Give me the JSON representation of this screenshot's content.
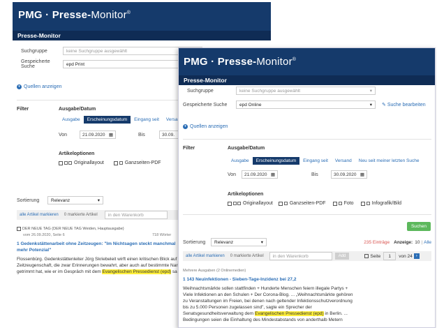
{
  "back": {
    "logo": {
      "pmg": "PMG",
      "sep": " · ",
      "presse": "Presse",
      "dash": "-",
      "monitor": "Monitor",
      "reg": "®"
    },
    "subtitle": "Presse-Monitor",
    "suchgruppe_label": "Suchgruppe",
    "suchgruppe_value": "keine Suchgruppe ausgewählt",
    "gespeicherte_label": "Gespeicherte Suche",
    "gespeicherte_value": "epd Print",
    "quellen_label": "Quellen anzeigen",
    "filter_label": "Filter",
    "ausgabe_datum_label": "Ausgabe/Datum",
    "tabs": [
      "Ausgabe",
      "Erscheinungsdatum",
      "Eingang seit",
      "Versand"
    ],
    "von_label": "Von",
    "von_value": "21.09.2020",
    "bis_label": "Bis",
    "bis_value": "30.09.",
    "artikeloptionen_label": "Artikeloptionen",
    "opt_original": "Originallayout",
    "opt_ganzseiten": "Ganzseiten-PDF",
    "sortierung_label": "Sortierung",
    "sortierung_value": "Relevanz",
    "alle_markieren": "alle Artikel markieren",
    "markierte": "0 markierte Artikel",
    "merkzettel": "in den Warenkorb",
    "source_line": "DER NEUE TAG (DER NEUE TAG Weiden, Hauptausgabe)",
    "source_date": "vom 26.09.2020, Seite 6",
    "words": "718 Wörter",
    "article_num": "1",
    "article_title": "Gedenkstättenarbeit ohne Zeitzeugen: \"Im Nichtsagen steckt manchmal mehr Potenzial\"",
    "body_1": "Flossenbürg. Gedenkstättenleiter Jörg Skriebeleit wirft einen kritischen Blick auf die",
    "body_2": "Zeitzeugenschaft, die zwar Erinnerungen bewahrt, aber auch auf bestimmte Narrative",
    "body_3_pre": "getrimmt hat, wie er im Gespräch mit dem ",
    "body_3_hl": "Evangelischen Pressedienst (epd)",
    "body_3_post": " sa"
  },
  "front": {
    "logo": {
      "pmg": "PMG",
      "sep": " · ",
      "presse": "Presse",
      "dash": "-",
      "monitor": "Monitor",
      "reg": "®"
    },
    "subtitle": "Presse-Monitor",
    "suchgruppe_label": "Suchgruppe",
    "suchgruppe_value": "keine Suchgruppe ausgewählt",
    "gespeicherte_label": "Gespeicherte Suche",
    "gespeicherte_value": "epd Online",
    "suche_bearbeiten": "Suche bearbeiten",
    "quellen_label": "Quellen anzeigen",
    "filter_label": "Filter",
    "ausgabe_datum_label": "Ausgabe/Datum",
    "tabs": [
      "Ausgabe",
      "Erscheinungsdatum",
      "Eingang seit",
      "Versand",
      "Neu seit meiner letzten Suche"
    ],
    "von_label": "Von",
    "von_value": "21.09.2020",
    "bis_label": "Bis",
    "bis_value": "30.09.2020",
    "artikeloptionen_label": "Artikeloptionen",
    "opt_original": "Originallayout",
    "opt_ganzseiten": "Ganzseiten-PDF",
    "opt_foto": "Foto",
    "opt_infografik": "Infografik/Bild",
    "suchen": "Suchen",
    "sortierung_label": "Sortierung",
    "sortierung_value": "Relevanz",
    "eintraege": "235 Einträge",
    "anzeige_label": "Anzeige:",
    "anzeige_value": "10",
    "anzeige_sep": "|",
    "anzeige_alle": "Alle",
    "alle_markieren": "alle Artikel markieren",
    "markierte": "0 markierte Artikel",
    "merkzettel": "in den Warenkorb",
    "add": "Add",
    "seite_label": "Seite",
    "seite_value": "1",
    "von_pages": "von 24",
    "mehrere": "Mehrere Ausgaben (2 Onlinemedien)",
    "article_num": "1",
    "article_title": "143 Neuinfektionen - Sieben-Tage-Inzidenz bei 27,2",
    "body_1": "Weihnachtsmärkte sollen stattfinden + Hunderte Menschen feiern illegale Partys +",
    "body_2": "Viele Infektionen an den Schulen + Der Corona-Blog. ... „Weihnachtsmärkte gehören",
    "body_3": "zu Veranstaltungen im Freien, bei denen nach geltender Infektionsschutzverordnung",
    "body_4": "bis zu 5.000 Personen zugelassen sind\", sagte ein Sprecher der",
    "body_5_pre": "Senatsgesundheitsverwaltung dem ",
    "body_5_hl": "Evangelischen Pressedienst (epd)",
    "body_5_post": " in Berlin. ...",
    "body_6": "Bedingungen seien die Einhaltung des Mindestabstands von anderthalb Metern"
  }
}
